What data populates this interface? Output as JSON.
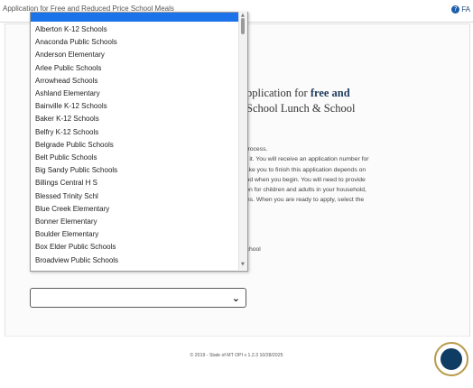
{
  "header": {
    "title": "Application for Free and Reduced Price School Meals",
    "faq_label": "FA"
  },
  "main": {
    "heading_lines": [
      "pplication for ",
      "free and",
      "School Lunch & School"
    ],
    "intro_lines": [
      "n process.",
      "",
      "ted it. You will receive an application number for",
      "ll take you to finish this application depends on",
      "hand when you begin. You will need to provide",
      "ation for children and adults in your household,",
      "rams. When you are ready to apply, select the"
    ],
    "intro2_lines": [
      "r school",
      "nd"
    ]
  },
  "dropdown": {
    "options": [
      "Alberton K-12 Schools",
      "Anaconda Public Schools",
      "Anderson Elementary",
      "Arlee Public Schools",
      "Arrowhead Schools",
      "Ashland Elementary",
      "Bainville K-12 Schools",
      "Baker K-12 Schools",
      "Belfry K-12 Schools",
      "Belgrade Public Schools",
      "Belt Public Schools",
      "Big Sandy Public Schools",
      "Billings Central H S",
      "Blessed Trinity Schl",
      "Blue Creek Elementary",
      "Bonner Elementary",
      "Boulder Elementary",
      "Box Elder Public Schools",
      "Broadview Public Schools"
    ],
    "selected_value": ""
  },
  "footer": {
    "copyright": "© 2019 - State of MT OPI  v 1.2.3 10/28/2025"
  },
  "colors": {
    "highlight": "#1a73e8",
    "accent": "#1f3b5c"
  }
}
